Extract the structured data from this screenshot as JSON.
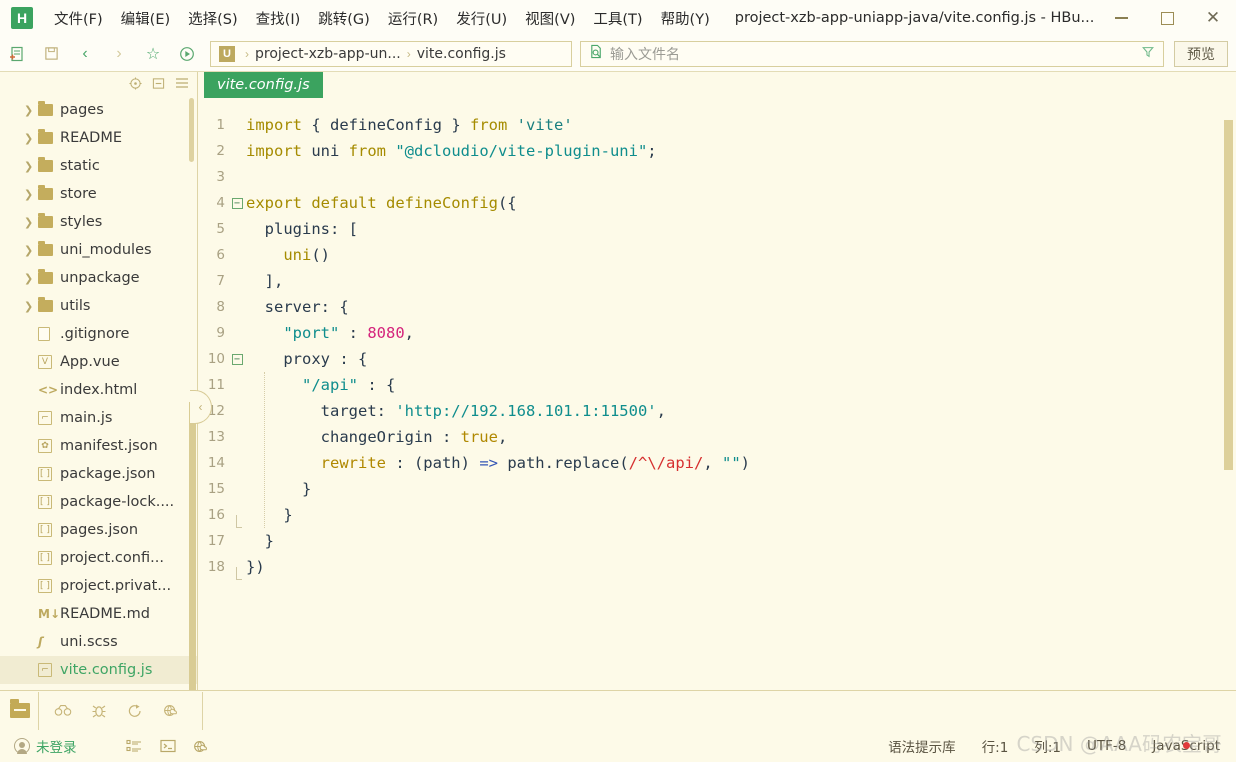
{
  "titlebar": {
    "logo": "H",
    "logo_icon": "app-logo-icon",
    "menus": [
      "文件(F)",
      "编辑(E)",
      "选择(S)",
      "查找(I)",
      "跳转(G)",
      "运行(R)",
      "发行(U)",
      "视图(V)",
      "工具(T)",
      "帮助(Y)"
    ],
    "title": "project-xzb-app-uniapp-java/vite.config.js - HBu...",
    "minimize_icon": "minimize-icon",
    "maximize_icon": "maximize-icon",
    "close_icon": "close-icon"
  },
  "toolbar": {
    "icons": [
      "new-file-icon",
      "save-icon",
      "back-icon",
      "forward-icon",
      "favorite-icon",
      "run-icon"
    ],
    "breadcrumb": {
      "project_badge": "U",
      "project": "project-xzb-app-un...",
      "separator": "›",
      "file": "vite.config.js"
    },
    "search": {
      "icon": "file-search-icon",
      "placeholder": "输入文件名",
      "value": "",
      "filter_icon": "filter-icon"
    },
    "preview_label": "预览"
  },
  "sidebar": {
    "header_icons": [
      "locate-file-icon",
      "collapse-all-icon",
      "menu-icon"
    ],
    "items": [
      {
        "label": "pages",
        "type": "folder",
        "expandable": true,
        "icon": "folder-icon",
        "selected": false
      },
      {
        "label": "README",
        "type": "folder",
        "expandable": true,
        "icon": "folder-icon",
        "selected": false
      },
      {
        "label": "static",
        "type": "folder",
        "expandable": true,
        "icon": "folder-icon",
        "selected": false
      },
      {
        "label": "store",
        "type": "folder",
        "expandable": true,
        "icon": "folder-icon",
        "selected": false
      },
      {
        "label": "styles",
        "type": "folder",
        "expandable": true,
        "icon": "folder-icon",
        "selected": false
      },
      {
        "label": "uni_modules",
        "type": "folder",
        "expandable": true,
        "icon": "folder-icon",
        "selected": false
      },
      {
        "label": "unpackage",
        "type": "folder",
        "expandable": true,
        "icon": "folder-icon",
        "selected": false
      },
      {
        "label": "utils",
        "type": "folder",
        "expandable": true,
        "icon": "folder-icon",
        "selected": false
      },
      {
        "label": ".gitignore",
        "type": "file",
        "expandable": false,
        "icon": "blank-file-icon",
        "selected": false
      },
      {
        "label": "App.vue",
        "type": "file",
        "expandable": false,
        "icon": "vue-file-icon",
        "glyph": "V",
        "selected": false
      },
      {
        "label": "index.html",
        "type": "file",
        "expandable": false,
        "icon": "html-file-icon",
        "glyph": "<>",
        "selected": false
      },
      {
        "label": "main.js",
        "type": "file",
        "expandable": false,
        "icon": "js-file-icon",
        "glyph": "J",
        "selected": false
      },
      {
        "label": "manifest.json",
        "type": "file",
        "expandable": false,
        "icon": "manifest-file-icon",
        "glyph": "✿",
        "selected": false
      },
      {
        "label": "package.json",
        "type": "file",
        "expandable": false,
        "icon": "json-file-icon",
        "glyph": "[ ]",
        "selected": false
      },
      {
        "label": "package-lock....",
        "type": "file",
        "expandable": false,
        "icon": "json-file-icon",
        "glyph": "[ ]",
        "selected": false
      },
      {
        "label": "pages.json",
        "type": "file",
        "expandable": false,
        "icon": "json-file-icon",
        "glyph": "[ ]",
        "selected": false
      },
      {
        "label": "project.confi...",
        "type": "file",
        "expandable": false,
        "icon": "json-file-icon",
        "glyph": "[ ]",
        "selected": false
      },
      {
        "label": "project.privat...",
        "type": "file",
        "expandable": false,
        "icon": "json-file-icon",
        "glyph": "[ ]",
        "selected": false
      },
      {
        "label": "README.md",
        "type": "file",
        "expandable": false,
        "icon": "markdown-file-icon",
        "glyph": "M↓",
        "selected": false
      },
      {
        "label": "uni.scss",
        "type": "file",
        "expandable": false,
        "icon": "scss-file-icon",
        "glyph": "S",
        "selected": false
      },
      {
        "label": "vite.config.js",
        "type": "file",
        "expandable": false,
        "icon": "js-file-icon",
        "glyph": "J",
        "selected": true
      }
    ],
    "collapse_handle_icon": "collapse-sidebar-icon"
  },
  "editor": {
    "tab_label": "vite.config.js",
    "accent_color": "#3ba35f",
    "background": "#fdfae8",
    "lines": [
      {
        "n": 1,
        "fold": "none",
        "tokens": [
          {
            "t": "import ",
            "c": "kw"
          },
          {
            "t": "{ ",
            "c": "op"
          },
          {
            "t": "defineConfig",
            "c": "ident"
          },
          {
            "t": " } ",
            "c": "op"
          },
          {
            "t": "from ",
            "c": "kw"
          },
          {
            "t": "'vite'",
            "c": "str"
          }
        ]
      },
      {
        "n": 2,
        "fold": "none",
        "tokens": [
          {
            "t": "import ",
            "c": "kw"
          },
          {
            "t": "uni ",
            "c": "ident"
          },
          {
            "t": "from ",
            "c": "kw"
          },
          {
            "t": "\"@dcloudio/vite-plugin-uni\"",
            "c": "str2"
          },
          {
            "t": ";",
            "c": "op"
          }
        ]
      },
      {
        "n": 3,
        "fold": "none",
        "tokens": []
      },
      {
        "n": 4,
        "fold": "open",
        "tokens": [
          {
            "t": "export default ",
            "c": "kw"
          },
          {
            "t": "defineConfig",
            "c": "fn"
          },
          {
            "t": "({",
            "c": "op"
          }
        ]
      },
      {
        "n": 5,
        "fold": "line",
        "tokens": [
          {
            "t": "  plugins: [",
            "c": "prop"
          }
        ]
      },
      {
        "n": 6,
        "fold": "line",
        "tokens": [
          {
            "t": "    ",
            "c": "op"
          },
          {
            "t": "uni",
            "c": "fn"
          },
          {
            "t": "()",
            "c": "op"
          }
        ]
      },
      {
        "n": 7,
        "fold": "line",
        "tokens": [
          {
            "t": "  ],",
            "c": "prop"
          }
        ]
      },
      {
        "n": 8,
        "fold": "line",
        "tokens": [
          {
            "t": "  server: {",
            "c": "prop"
          }
        ]
      },
      {
        "n": 9,
        "fold": "line",
        "tokens": [
          {
            "t": "    ",
            "c": "op"
          },
          {
            "t": "\"port\"",
            "c": "str2"
          },
          {
            "t": " : ",
            "c": "op"
          },
          {
            "t": "8080",
            "c": "num"
          },
          {
            "t": ",",
            "c": "op"
          }
        ]
      },
      {
        "n": 10,
        "fold": "open2",
        "tokens": [
          {
            "t": "    proxy : {",
            "c": "prop"
          }
        ]
      },
      {
        "n": 11,
        "fold": "line2",
        "tokens": [
          {
            "t": "      ",
            "c": "op"
          },
          {
            "t": "\"/api\"",
            "c": "str2"
          },
          {
            "t": " : {",
            "c": "op"
          }
        ]
      },
      {
        "n": 12,
        "fold": "line2",
        "tokens": [
          {
            "t": "        target: ",
            "c": "prop"
          },
          {
            "t": "'http://192.168.101.1:11500'",
            "c": "str2"
          },
          {
            "t": ",",
            "c": "op"
          }
        ]
      },
      {
        "n": 13,
        "fold": "line2",
        "tokens": [
          {
            "t": "        changeOrigin : ",
            "c": "prop"
          },
          {
            "t": "true",
            "c": "bool"
          },
          {
            "t": ",",
            "c": "op"
          }
        ]
      },
      {
        "n": 14,
        "fold": "line2",
        "tokens": [
          {
            "t": "        ",
            "c": "op"
          },
          {
            "t": "rewrite",
            "c": "bool"
          },
          {
            "t": " : (path) ",
            "c": "op"
          },
          {
            "t": "=>",
            "c": "arrow"
          },
          {
            "t": " path.",
            "c": "op"
          },
          {
            "t": "replace",
            "c": "ident"
          },
          {
            "t": "(",
            "c": "op"
          },
          {
            "t": "/^\\/api/",
            "c": "regex"
          },
          {
            "t": ", ",
            "c": "op"
          },
          {
            "t": "\"\"",
            "c": "str2"
          },
          {
            "t": ")",
            "c": "op"
          }
        ]
      },
      {
        "n": 15,
        "fold": "line2",
        "tokens": [
          {
            "t": "      }",
            "c": "op"
          }
        ]
      },
      {
        "n": 16,
        "fold": "end2",
        "tokens": [
          {
            "t": "    }",
            "c": "op"
          }
        ]
      },
      {
        "n": 17,
        "fold": "line",
        "tokens": [
          {
            "t": "  }",
            "c": "op"
          }
        ]
      },
      {
        "n": 18,
        "fold": "end",
        "tokens": [
          {
            "t": "})",
            "c": "op"
          }
        ]
      }
    ]
  },
  "bottom_tabs": {
    "icons": [
      "project-panel-icon",
      "search-panel-icon",
      "debug-panel-icon",
      "terminal-panel-icon",
      "browser-panel-icon"
    ]
  },
  "statusbar": {
    "login_icon": "user-icon",
    "login_text": "未登录",
    "left_icons": [
      "outline-icon",
      "terminal-icon",
      "browser-icon"
    ],
    "syntax_hint": "语法提示库",
    "row": "行:1",
    "col": "列:1",
    "encoding": "UTF-8",
    "language": "JavaScript"
  },
  "watermark": {
    "text": "CSDN @AAA码农宝哥"
  }
}
